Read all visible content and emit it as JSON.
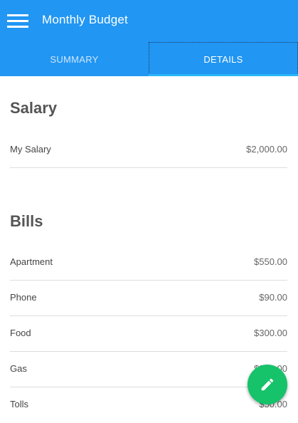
{
  "app_bar": {
    "title": "Monthly Budget",
    "menu_icon": "hamburger-menu-icon",
    "color": "#2196f3"
  },
  "tabs": [
    {
      "label": "SUMMARY",
      "selected": false
    },
    {
      "label": "DETAILS",
      "selected": true
    }
  ],
  "sections": {
    "salary": {
      "title": "Salary",
      "items": [
        {
          "label": "My Salary",
          "value": "$2,000.00"
        }
      ]
    },
    "bills": {
      "title": "Bills",
      "items": [
        {
          "label": "Apartment",
          "value": "$550.00"
        },
        {
          "label": "Phone",
          "value": "$90.00"
        },
        {
          "label": "Food",
          "value": "$300.00"
        },
        {
          "label": "Gas",
          "value": "$300.00"
        },
        {
          "label": "Tolls",
          "value": "$50.00"
        }
      ]
    }
  },
  "fab": {
    "icon": "edit-pencil-icon",
    "color": "#16c26a"
  }
}
